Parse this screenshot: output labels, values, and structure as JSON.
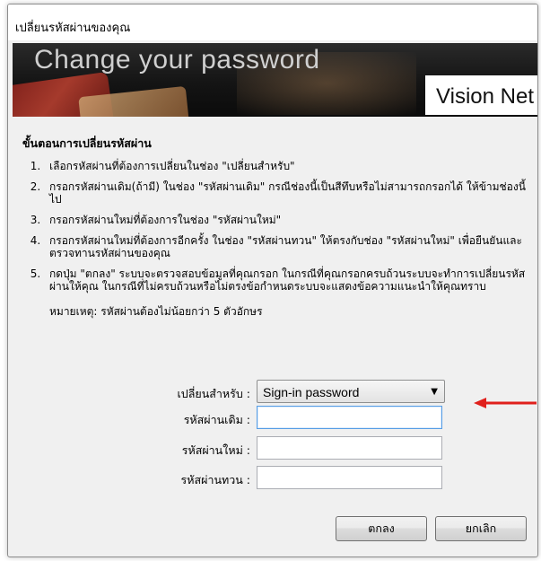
{
  "window": {
    "title": "เปลี่ยนรหัสผ่านของคุณ"
  },
  "banner": {
    "headline": "Change your password",
    "brand": "Vision Net"
  },
  "instructions": {
    "heading": "ขั้นตอนการเปลี่ยนรหัสผ่าน",
    "steps": [
      "เลือกรหัสผ่านที่ต้องการเปลี่ยนในช่อง \"เปลี่ยนสำหรับ\"",
      "กรอกรหัสผ่านเดิม(ถ้ามี) ในช่อง \"รหัสผ่านเดิม\" กรณีช่องนี้เป็นสีทึบหรือไม่สามารถกรอกได้ ให้ข้ามช่องนี้ไป",
      "กรอกรหัสผ่านใหม่ที่ต้องการในช่อง \"รหัสผ่านใหม่\"",
      "กรอกรหัสผ่านใหม่ที่ต้องการอีกครั้ง ในช่อง \"รหัสผ่านทวน\" ให้ตรงกับช่อง \"รหัสผ่านใหม่\" เพื่อยืนยันและตรวจทานรหัสผ่านของคุณ",
      "กดปุ่ม \"ตกลง\" ระบบจะตรวจสอบข้อมูลที่คุณกรอก ในกรณีที่คุณกรอกครบถ้วนระบบจะทำการเปลี่ยนรหัสผ่านให้คุณ ในกรณีที่ไม่ครบถ้วนหรือไม่ตรงข้อกำหนดระบบจะแสดงข้อความแนะนำให้คุณทราบ"
    ],
    "note": "หมายเหตุ: รหัสผ่านต้องไม่น้อยกว่า 5 ตัวอักษร"
  },
  "form": {
    "change_for_label": "เปลี่ยนสำหรับ :",
    "change_for_value": "Sign-in password",
    "old_password_label": "รหัสผ่านเดิม :",
    "old_password_value": "",
    "new_password_label": "รหัสผ่านใหม่ :",
    "new_password_value": "",
    "confirm_password_label": "รหัสผ่านทวน :",
    "confirm_password_value": ""
  },
  "buttons": {
    "ok_label": "ตกลง",
    "cancel_label": "ยกเลิก"
  },
  "colors": {
    "annotation_arrow": "#e0201c",
    "focus_border": "#569de5"
  }
}
